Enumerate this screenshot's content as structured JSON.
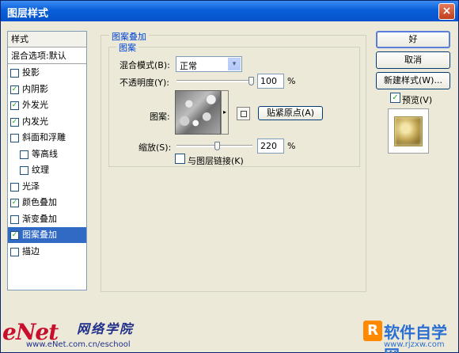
{
  "window": {
    "title": "图层样式",
    "close": "×"
  },
  "sidebar": {
    "header": "样式",
    "blend_options": "混合选项:默认",
    "items": [
      {
        "label": "投影",
        "checked": false
      },
      {
        "label": "内阴影",
        "checked": true
      },
      {
        "label": "外发光",
        "checked": true
      },
      {
        "label": "内发光",
        "checked": true
      },
      {
        "label": "斜面和浮雕",
        "checked": false
      },
      {
        "label": "等高线",
        "checked": false
      },
      {
        "label": "纹理",
        "checked": false
      },
      {
        "label": "光泽",
        "checked": false
      },
      {
        "label": "颜色叠加",
        "checked": true
      },
      {
        "label": "渐变叠加",
        "checked": false
      },
      {
        "label": "图案叠加",
        "checked": true
      },
      {
        "label": "描边",
        "checked": false
      }
    ],
    "checkmark": "✓"
  },
  "panel": {
    "group_title": "图案叠加",
    "subgroup_title": "图案",
    "blend_mode_label": "混合模式(B):",
    "blend_mode_value": "正常",
    "opacity_label": "不透明度(Y):",
    "opacity_value": "100",
    "opacity_unit": "%",
    "pattern_label": "图案:",
    "snap_origin_button": "贴紧原点(A)",
    "scale_label": "缩放(S):",
    "scale_value": "220",
    "scale_unit": "%",
    "link_label": "与图层链接(K)",
    "link_checked": false,
    "dropdown_arrow": "▾",
    "swatch_arrow": "▸"
  },
  "buttons": {
    "ok": "好",
    "cancel": "取消",
    "new_style": "新建样式(W)...",
    "preview_label": "预览(V)",
    "preview_checked": true
  },
  "watermark": {
    "enet": "eNet",
    "school": "网络学院",
    "url": "www.eNet.com.cn/eschool",
    "rj_logo": "R",
    "rj_text": "软件自学网",
    "rj_url": "www.rjzxw.com"
  }
}
